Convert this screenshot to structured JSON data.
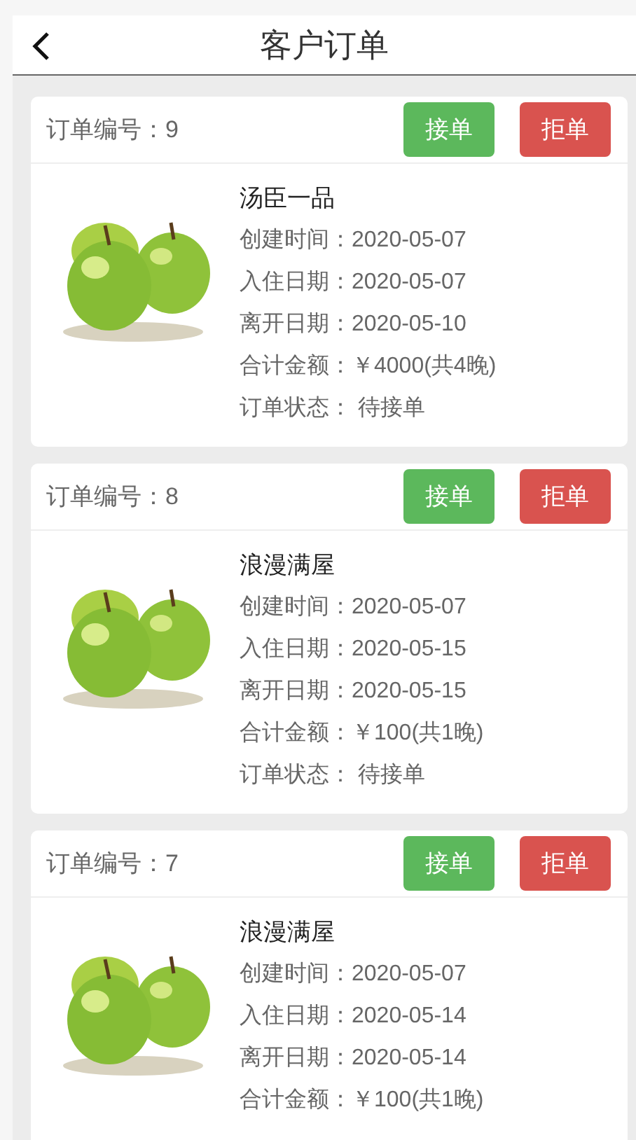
{
  "header": {
    "title": "客户订单"
  },
  "orders": [
    {
      "order_no": "订单编号：9",
      "accept": "接单",
      "reject": "拒单",
      "hotel": "汤臣一品",
      "lines": [
        "创建时间：2020-05-07",
        "入住日期：2020-05-07",
        "离开日期：2020-05-10",
        "合计金额：￥4000(共4晚)",
        "订单状态： 待接单"
      ]
    },
    {
      "order_no": "订单编号：8",
      "accept": "接单",
      "reject": "拒单",
      "hotel": "浪漫满屋",
      "lines": [
        "创建时间：2020-05-07",
        "入住日期：2020-05-15",
        "离开日期：2020-05-15",
        "合计金额：￥100(共1晚)",
        "订单状态： 待接单"
      ]
    },
    {
      "order_no": "订单编号：7",
      "accept": "接单",
      "reject": "拒单",
      "hotel": "浪漫满屋",
      "lines": [
        "创建时间：2020-05-07",
        "入住日期：2020-05-14",
        "离开日期：2020-05-14",
        "合计金额：￥100(共1晚)"
      ]
    }
  ]
}
